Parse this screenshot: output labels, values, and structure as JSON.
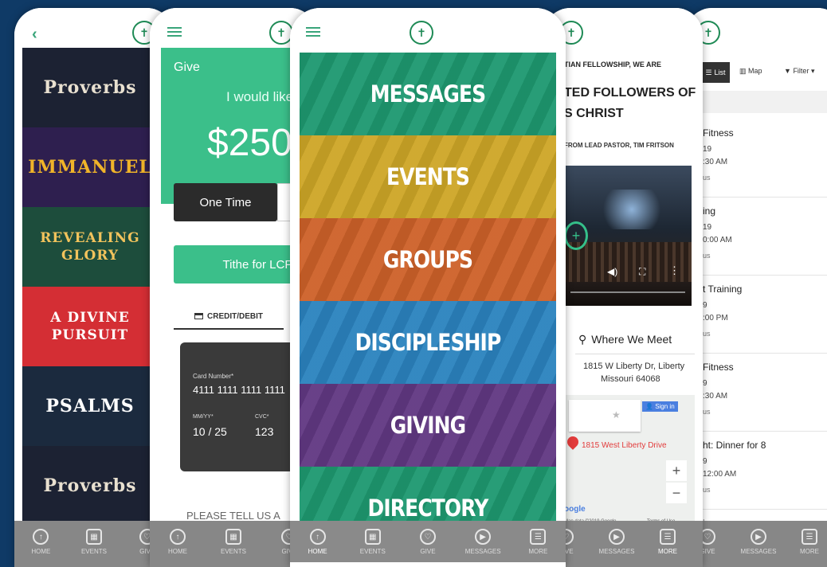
{
  "screen1": {
    "series": [
      {
        "title": "Proverbs",
        "bg": "#1c2233",
        "color": "#e8e0d0"
      },
      {
        "title": "IMMANUEL",
        "bg": "#2e1f4f",
        "color": "#f0b429"
      },
      {
        "title": "REVEALING GLORY",
        "bg": "#1d4d3c",
        "color": "#f2c35c"
      },
      {
        "title": "A DIVINE PURSUIT",
        "bg": "#d42e34",
        "color": "#ffffff"
      },
      {
        "title": "PSALMS",
        "bg": "#1b2a3e",
        "color": "#ffffff"
      },
      {
        "title": "Proverbs",
        "bg": "#1c2233",
        "color": "#e8e0d0"
      }
    ],
    "tabs": [
      {
        "icon": "up-arrow",
        "label": "HOME"
      },
      {
        "icon": "calendar",
        "label": "EVENTS"
      },
      {
        "icon": "heart",
        "label": "GIVE"
      }
    ]
  },
  "screen2": {
    "give_title": "Give",
    "prompt": "I would like",
    "amount": "$250",
    "freq_one": "One Time",
    "fund": "Tithe for LCF",
    "method_tab": "CREDIT/DEBIT",
    "card_number_label": "Card Number*",
    "card_number": "4111 1111 1111 1111",
    "exp_label": "MM/YY*",
    "exp": "10 / 25",
    "cvc_label": "CVC*",
    "cvc": "123",
    "tell_us": "PLEASE TELL US A",
    "tabs": [
      {
        "icon": "up-arrow",
        "label": "HOME"
      },
      {
        "icon": "calendar",
        "label": "EVENTS"
      },
      {
        "icon": "heart",
        "label": "GIVE"
      }
    ]
  },
  "screen3": {
    "menu": [
      {
        "label": "MESSAGES",
        "color": "#21a77a"
      },
      {
        "label": "EVENTS",
        "color": "#e1b52a"
      },
      {
        "label": "GROUPS",
        "color": "#e06a2c"
      },
      {
        "label": "DISCIPLESHIP",
        "color": "#2f8fd0"
      },
      {
        "label": "GIVING",
        "color": "#6a3d8e"
      },
      {
        "label": "DIRECTORY",
        "color": "#21a77a"
      }
    ],
    "tabs": [
      {
        "icon": "up-arrow",
        "label": "HOME"
      },
      {
        "icon": "calendar",
        "label": "EVENTS"
      },
      {
        "icon": "heart",
        "label": "GIVE"
      },
      {
        "icon": "play",
        "label": "MESSAGES"
      },
      {
        "icon": "menu",
        "label": "MORE"
      }
    ]
  },
  "screen4": {
    "line1": "TIAN FELLOWSHIP, WE ARE",
    "heading1": "TED FOLLOWERS OF",
    "heading2": "S CHRIST",
    "from": "FROM LEAD PASTOR, TIM FRITSON",
    "where_title": "Where We Meet",
    "address1": "1815 W Liberty Dr, Liberty",
    "address2": "Missouri 64068",
    "sign_in": "Sign in",
    "map_pin": "1815 West Liberty Drive",
    "map_logo": "oogle",
    "map_data": "Map data ©2019 Google",
    "map_terms": "Terms of Use",
    "tabs": [
      {
        "icon": "heart",
        "label": "GIVE"
      },
      {
        "icon": "play",
        "label": "MESSAGES"
      },
      {
        "icon": "menu",
        "label": "MORE"
      }
    ]
  },
  "screen5": {
    "list_label": "List",
    "map_label": "Map",
    "filter_label": "Filter",
    "events": [
      {
        "title": "Fitness",
        "date": "19",
        "time": ":30 AM",
        "loc": "us"
      },
      {
        "title": "ing",
        "date": "19",
        "time": "0:00 AM",
        "loc": "us"
      },
      {
        "title": "t Training",
        "date": "9",
        "time": ":00 PM",
        "loc": "us"
      },
      {
        "title": "Fitness",
        "date": "9",
        "time": ":30 AM",
        "loc": "us"
      },
      {
        "title": "ht: Dinner for 8",
        "date": "9",
        "time": "12:00 AM",
        "loc": "us"
      },
      {
        "title": "ing",
        "date": "",
        "time": "",
        "loc": ""
      }
    ],
    "tabs": [
      {
        "icon": "heart",
        "label": "GIVE"
      },
      {
        "icon": "play",
        "label": "MESSAGES"
      },
      {
        "icon": "menu",
        "label": "MORE"
      }
    ]
  }
}
